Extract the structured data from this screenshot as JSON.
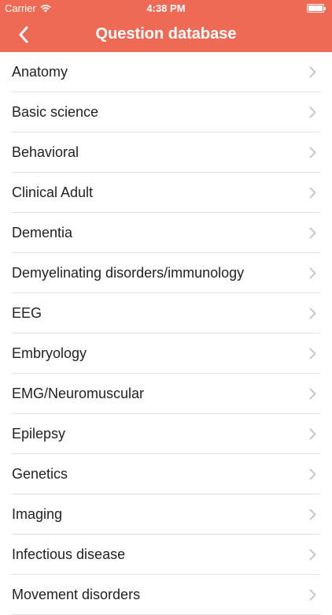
{
  "status_bar": {
    "carrier": "Carrier",
    "time": "4:38 PM"
  },
  "nav": {
    "title": "Question database",
    "back_icon": "chevron-left-icon"
  },
  "colors": {
    "header": "#ef6a55",
    "chevron": "#c7c7cc",
    "separator": "#e2e2e2"
  },
  "categories": [
    {
      "label": "Anatomy"
    },
    {
      "label": "Basic science"
    },
    {
      "label": "Behavioral"
    },
    {
      "label": "Clinical Adult"
    },
    {
      "label": "Dementia"
    },
    {
      "label": "Demyelinating disorders/immunology"
    },
    {
      "label": "EEG"
    },
    {
      "label": "Embryology"
    },
    {
      "label": "EMG/Neuromuscular"
    },
    {
      "label": "Epilepsy"
    },
    {
      "label": "Genetics"
    },
    {
      "label": "Imaging"
    },
    {
      "label": "Infectious disease"
    },
    {
      "label": "Movement disorders"
    }
  ]
}
